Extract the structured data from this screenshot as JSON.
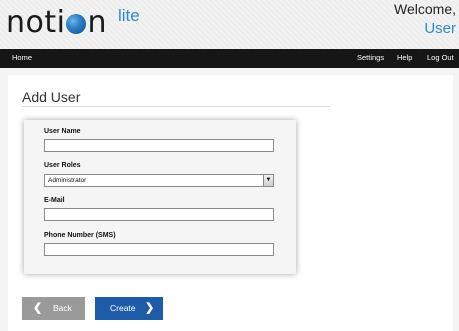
{
  "header": {
    "logo_text_before": "noti",
    "logo_text_after": "n",
    "logo_suffix": "lite",
    "welcome": "Welcome,",
    "username": "User"
  },
  "nav": {
    "home": "Home",
    "settings": "Settings",
    "help": "Help",
    "logout": "Log Out"
  },
  "page": {
    "title": "Add User"
  },
  "form": {
    "user_name_label": "User Name",
    "user_name_value": "",
    "user_roles_label": "User Roles",
    "user_roles_selected": "Administrator",
    "email_label": "E-Mail",
    "email_value": "",
    "phone_label": "Phone Number (SMS)",
    "phone_value": ""
  },
  "buttons": {
    "back": "Back",
    "create": "Create"
  },
  "colors": {
    "accent_blue": "#2f8ad0",
    "create_button": "#1e5ca8",
    "back_button": "#9a9a9a",
    "navbar": "#161616"
  },
  "icons": {
    "back": "chevron-left-icon",
    "create": "chevron-right-icon",
    "select": "dropdown-arrow-icon"
  }
}
